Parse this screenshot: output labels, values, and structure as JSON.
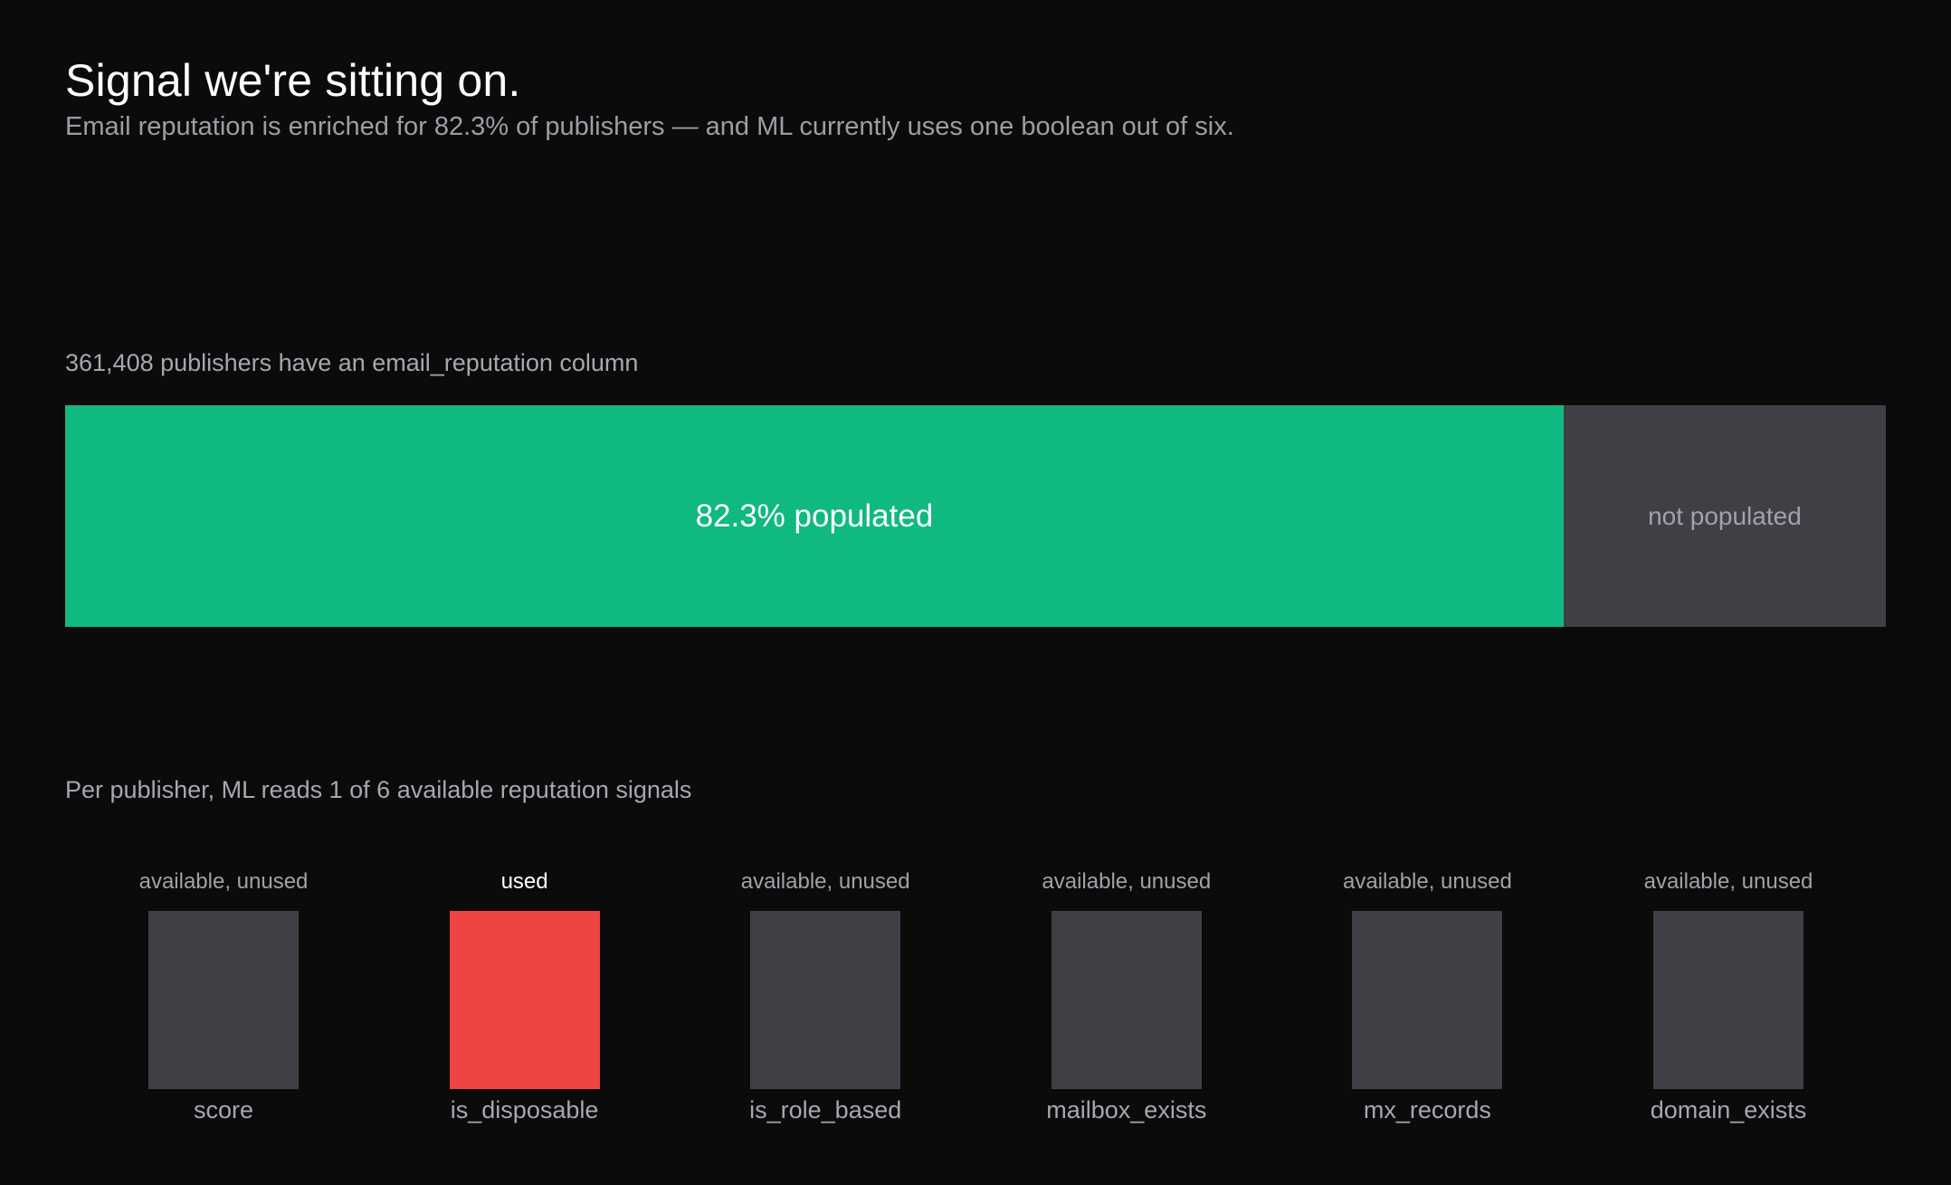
{
  "header": {
    "title": "Signal we're sitting on.",
    "subtitle": "Email reputation is enriched for 82.3% of publishers — and ML currently uses one boolean out of six."
  },
  "colors": {
    "populated": "#10b981",
    "unpopulated": "#3f3f46",
    "used": "#ef4444",
    "unused": "#3f3f46",
    "background": "#0b0b0c"
  },
  "chart_data": [
    {
      "type": "bar",
      "orientation": "horizontal-stacked",
      "title": "361,408 publishers have an email_reputation column",
      "total_publishers": 361408,
      "segments": [
        {
          "label": "82.3% populated",
          "value": 82.3,
          "status": "populated"
        },
        {
          "label": "not populated",
          "value": 17.7,
          "status": "not populated"
        }
      ]
    },
    {
      "type": "bar",
      "title": "Per publisher, ML reads 1 of 6 available reputation signals",
      "categories": [
        "score",
        "is_disposable",
        "is_role_based",
        "mailbox_exists",
        "mx_records",
        "domain_exists"
      ],
      "states": [
        "available, unused",
        "used",
        "available, unused",
        "available, unused",
        "available, unused",
        "available, unused"
      ],
      "used": [
        false,
        true,
        false,
        false,
        false,
        false
      ]
    }
  ]
}
